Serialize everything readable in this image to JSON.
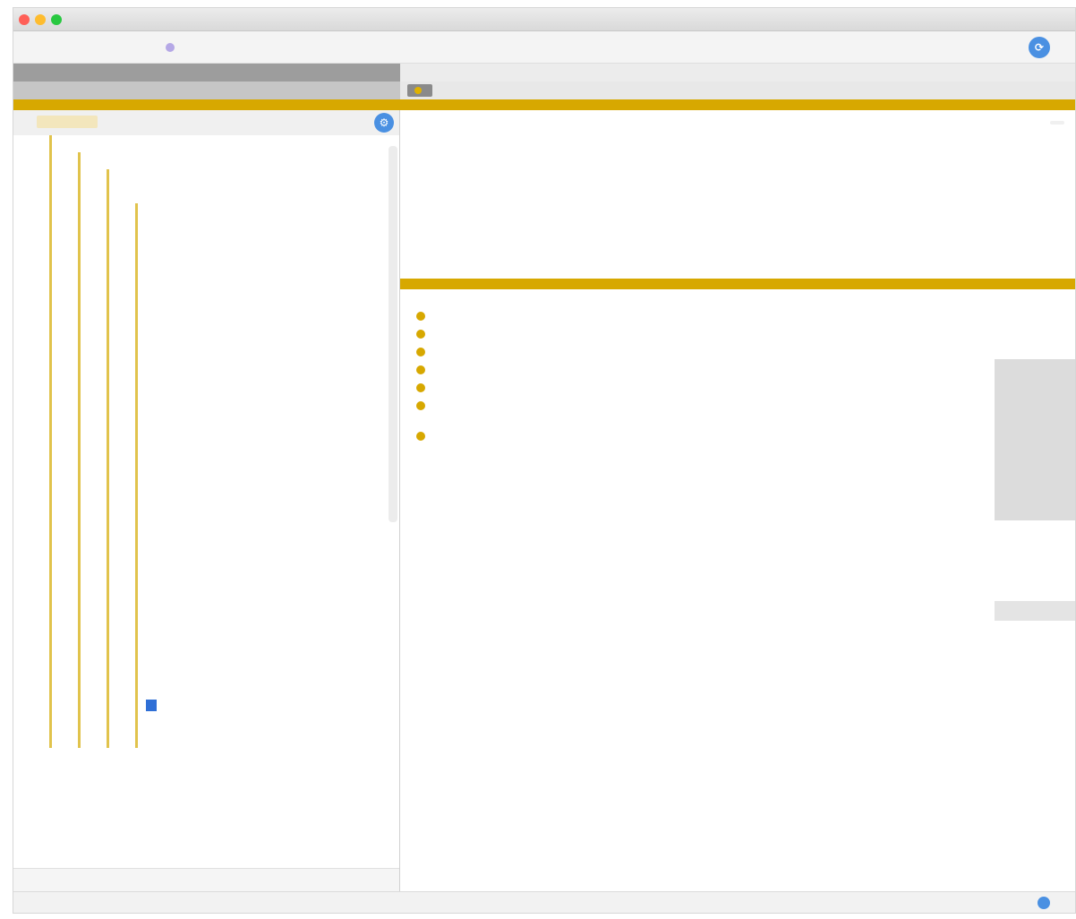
{
  "window": {
    "title": ""
  },
  "toolbar": {
    "left_label": "",
    "right_label": ""
  },
  "tabs": {
    "left_row1": "",
    "left_row2": [
      "",
      ""
    ],
    "right_row1": "",
    "active_tab": ""
  },
  "sidebar": {
    "header_label": "",
    "footer_label": "",
    "tree": [
      {
        "label": "",
        "depth": 0
      },
      {
        "label": "",
        "depth": 1
      },
      {
        "label": "",
        "depth": 2
      },
      {
        "label": "",
        "depth": 2
      },
      {
        "label": "",
        "depth": 3
      },
      {
        "label": "",
        "depth": 3
      },
      {
        "label": "",
        "depth": 3
      },
      {
        "label": "",
        "depth": 3
      },
      {
        "label": "",
        "depth": 3
      },
      {
        "label": "",
        "depth": 3
      },
      {
        "label": "",
        "depth": 3
      },
      {
        "label": "",
        "depth": 3
      },
      {
        "label": "",
        "depth": 3
      },
      {
        "label": "",
        "depth": 3
      },
      {
        "label": "",
        "depth": 3
      },
      {
        "label": "",
        "depth": 3
      },
      {
        "label": "",
        "depth": 3
      },
      {
        "label": "",
        "depth": 3
      },
      {
        "label": "",
        "depth": 3
      },
      {
        "label": "",
        "depth": 3
      },
      {
        "label": "",
        "depth": 3
      },
      {
        "label": "",
        "depth": 3
      },
      {
        "label": "",
        "depth": 3
      },
      {
        "label": "",
        "depth": 3
      },
      {
        "label": "",
        "depth": 3
      },
      {
        "label": "",
        "depth": 3
      },
      {
        "label": "",
        "depth": 3
      },
      {
        "label": "",
        "depth": 3
      },
      {
        "label": "",
        "depth": 3
      },
      {
        "label": "",
        "depth": 3
      },
      {
        "label": "",
        "depth": 3
      },
      {
        "label": "",
        "depth": 3
      },
      {
        "label": "",
        "depth": 3
      },
      {
        "label": "",
        "depth": 3,
        "selected": true
      },
      {
        "label": "",
        "depth": 3
      },
      {
        "label": "",
        "depth": 3
      }
    ]
  },
  "commit": {
    "author": "",
    "date": "",
    "title": "",
    "subtitle": "",
    "body": "",
    "hash": ""
  },
  "diff": {
    "section1_label": "",
    "section2_label": "",
    "changed_files": [
      {
        "name": "",
        "ext": ""
      },
      {
        "name": "",
        "ext": ""
      },
      {
        "name": "",
        "ext": ""
      },
      {
        "name": "",
        "ext": ""
      },
      {
        "name": "",
        "ext": ""
      },
      {
        "name": "",
        "ext": ""
      }
    ],
    "meta_lines": [
      "",
      ""
    ],
    "other_file": {
      "name": "",
      "ext": ""
    },
    "other_stat": "",
    "footer_lines": [
      "",
      "",
      "",
      ""
    ]
  },
  "statusbar": {
    "left": "",
    "middle": "",
    "right": ""
  },
  "colors": {
    "accent": "#d7a800",
    "selection": "#2f6fd6",
    "link": "#4a90e2",
    "ext_highlight": "#f0c6f0"
  }
}
